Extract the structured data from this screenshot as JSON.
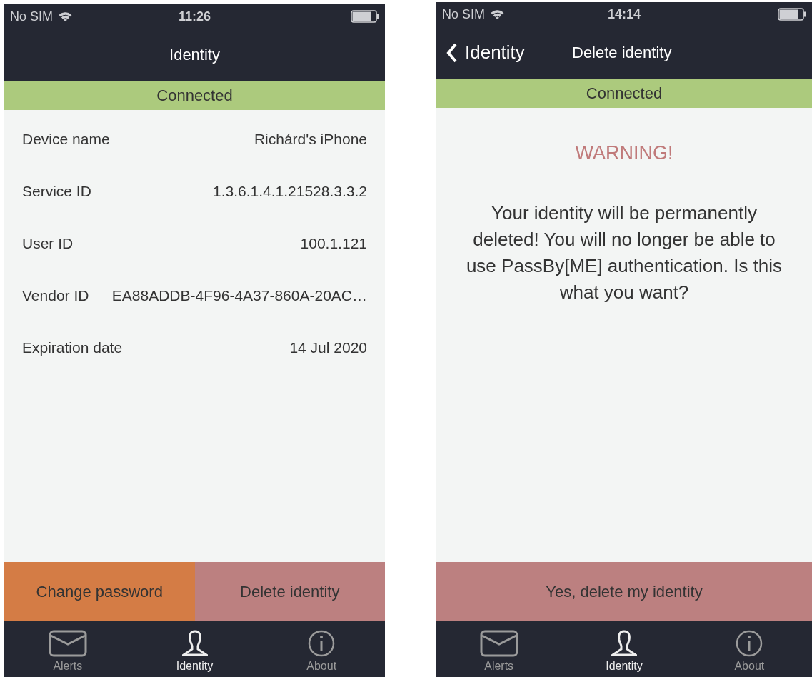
{
  "screens": [
    {
      "kind": "details",
      "status_bar": {
        "carrier": "No SIM",
        "time": "11:26"
      },
      "nav": {
        "title": "Identity"
      },
      "connection": {
        "label": "Connected",
        "connected": true
      },
      "fields": [
        {
          "label": "Device name",
          "value": "Richárd's iPhone"
        },
        {
          "label": "Service ID",
          "value": "1.3.6.1.4.1.21528.3.3.2"
        },
        {
          "label": "User ID",
          "value": "100.1.121"
        },
        {
          "label": "Vendor ID",
          "value": "EA88ADDB-4F96-4A37-860A-20AC…"
        },
        {
          "label": "Expiration date",
          "value": "14 Jul 2020"
        }
      ],
      "buttons": [
        {
          "label": "Change password",
          "kind": "primary"
        },
        {
          "label": "Delete identity",
          "kind": "danger"
        }
      ],
      "tabs": [
        {
          "label": "Alerts",
          "kind": "alerts",
          "selected": false
        },
        {
          "label": "Identity",
          "kind": "identity",
          "selected": true
        },
        {
          "label": "About",
          "kind": "about",
          "selected": false
        }
      ]
    },
    {
      "kind": "confirm",
      "status_bar": {
        "carrier": "No SIM",
        "time": "14:14"
      },
      "nav": {
        "back": "Identity",
        "title": "Delete identity"
      },
      "connection": {
        "label": "Connected",
        "connected": true
      },
      "warning": {
        "title": "WARNING!",
        "message": "Your identity will be permanently deleted! You will no longer be able to use PassBy[ME] authentication. Is this what you want?"
      },
      "buttons": [
        {
          "label": "Yes, delete my identity",
          "kind": "danger"
        }
      ],
      "tabs": [
        {
          "label": "Alerts",
          "kind": "alerts",
          "selected": false
        },
        {
          "label": "Identity",
          "kind": "identity",
          "selected": true
        },
        {
          "label": "About",
          "kind": "about",
          "selected": false
        }
      ]
    }
  ]
}
